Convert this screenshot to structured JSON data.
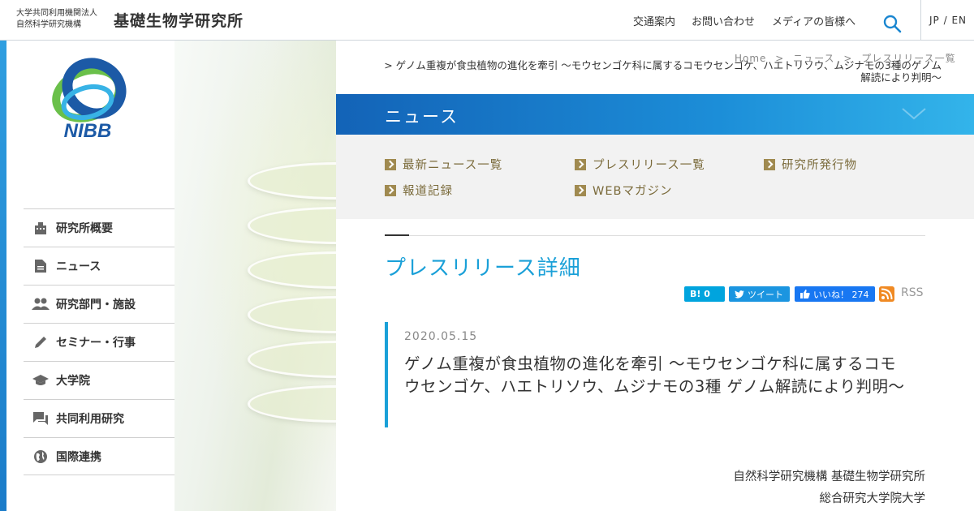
{
  "header": {
    "org_line1": "大学共同利用機関法人",
    "org_line2": "自然科学研究機構",
    "org_title": "基礎生物学研究所",
    "nav": [
      "交通案内",
      "お問い合わせ",
      "メディアの皆様へ"
    ],
    "lang": "JP / EN",
    "search_icon": "search-icon"
  },
  "logo": {
    "text": "NIBB"
  },
  "sidebar": {
    "items": [
      {
        "label": "研究所概要",
        "icon": "building-icon"
      },
      {
        "label": "ニュース",
        "icon": "document-icon"
      },
      {
        "label": "研究部門・施設",
        "icon": "people-icon"
      },
      {
        "label": "セミナー・行事",
        "icon": "pencil-icon"
      },
      {
        "label": "大学院",
        "icon": "graduation-cap-icon"
      },
      {
        "label": "共同利用研究",
        "icon": "chat-icon"
      },
      {
        "label": "国際連携",
        "icon": "globe-icon"
      }
    ]
  },
  "breadcrumb": {
    "items": [
      "Home",
      "ニュース",
      "プレスリリース一覧"
    ],
    "current": "ゲノム重複が食虫植物の進化を牽引 〜モウセンゴケ科に属するコモウセンゴケ、ハエトリソウ、ムジナモの3種のゲノム解読により判明〜",
    "sep": ">"
  },
  "banner": {
    "title": "ニュース"
  },
  "subnav": {
    "links": [
      "最新ニュース一覧",
      "プレスリリース一覧",
      "研究所発行物",
      "報道記録",
      "WEBマガジン"
    ]
  },
  "content": {
    "section_title": "プレスリリース詳細",
    "share": {
      "hatena": "B! 0",
      "tweet": "ツイート",
      "like": "いいね！ 274",
      "rss": "RSS"
    },
    "article": {
      "date": "2020.05.15",
      "headline": "ゲノム重複が食虫植物の進化を牽引 〜モウセンゴケ科に属するコモウセンゴケ、ハエトリソウ、ムジナモの3種 ゲノム解読により判明〜"
    },
    "orgs": [
      "自然科学研究機構 基礎生物学研究所",
      "総合研究大学院大学"
    ]
  },
  "colors": {
    "accent": "#1aa0d8",
    "banner_dark": "#1363b7",
    "subnav_text": "#7a6a3a"
  }
}
